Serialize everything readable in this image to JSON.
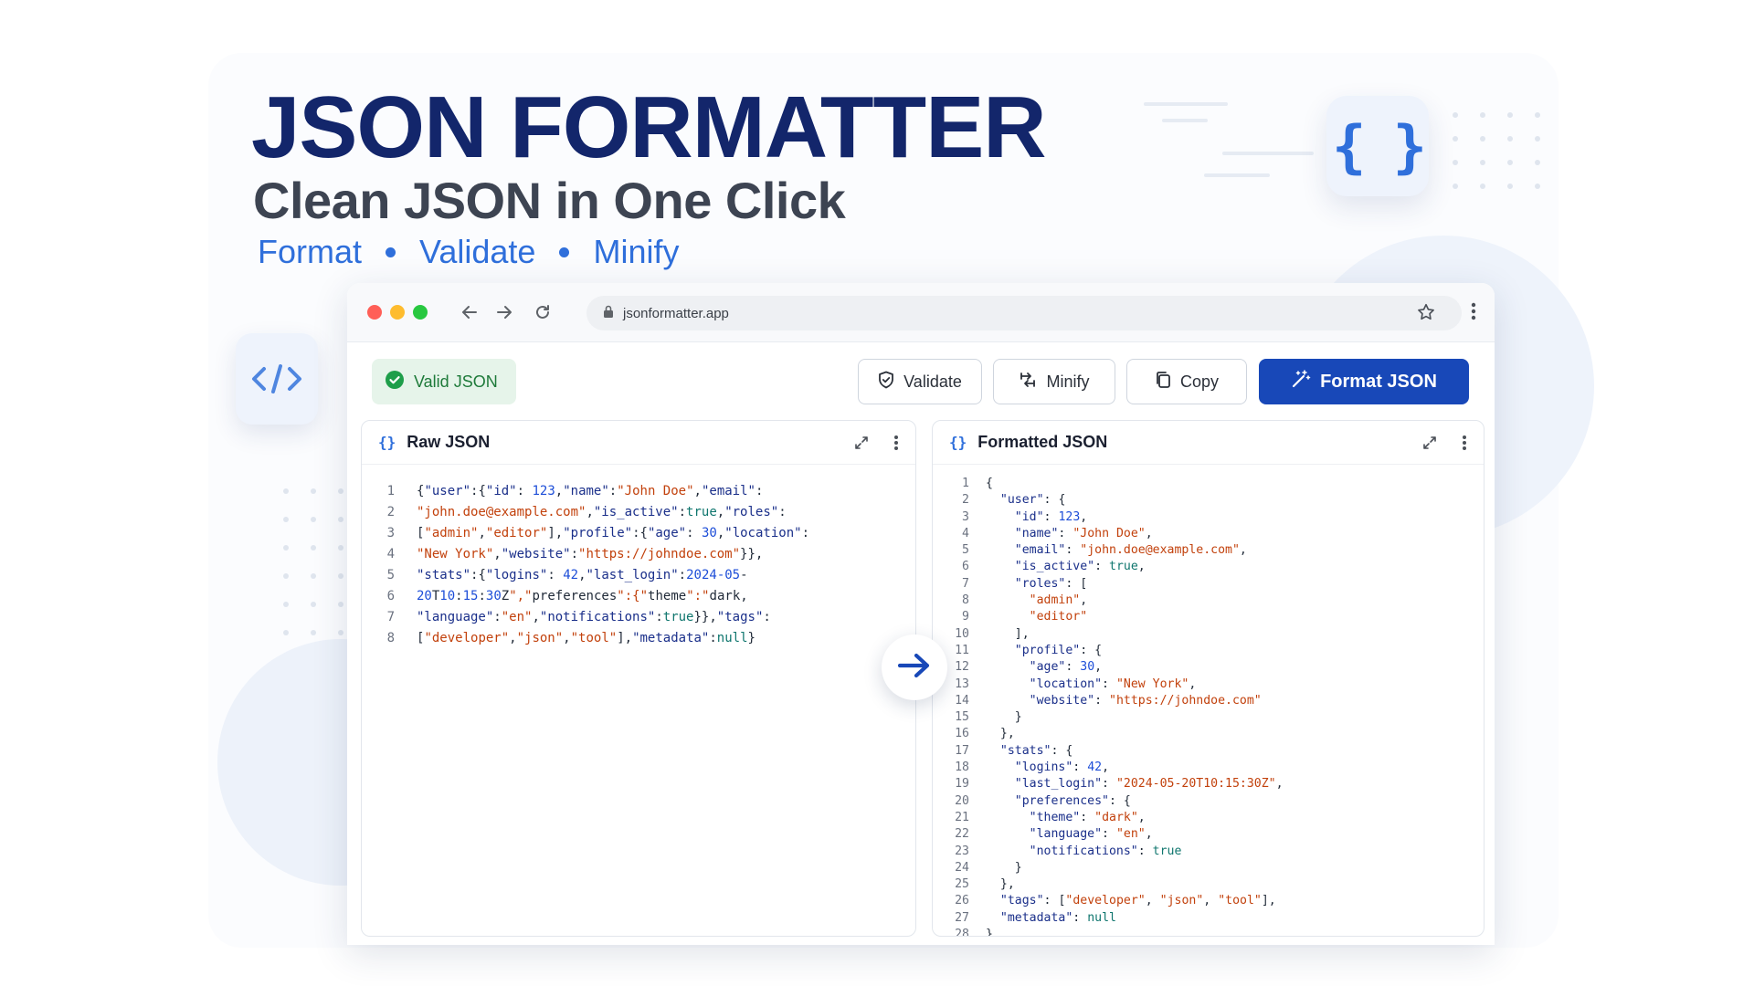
{
  "hero": {
    "title": "JSON FORMATTER",
    "subtitle": "Clean JSON in One Click",
    "features": [
      "Format",
      "Validate",
      "Minify"
    ],
    "badge_glyph": "{ }"
  },
  "colors": {
    "primary": "#1848b8",
    "title": "#13266b",
    "accent": "#2f6fdb",
    "valid_bg": "#e6f4ea",
    "valid_text": "#1e7a3a"
  },
  "browser": {
    "url": "jsonformatter.app",
    "icons": [
      "back-arrow-icon",
      "forward-arrow-icon",
      "reload-icon",
      "lock-icon",
      "star-icon",
      "kebab-menu-icon"
    ]
  },
  "toolbar": {
    "status_label": "Valid JSON",
    "validate_label": "Validate",
    "minify_label": "Minify",
    "copy_label": "Copy",
    "format_label": "Format JSON"
  },
  "raw_pane": {
    "title": "Raw JSON",
    "lines": [
      "{\"user\":{\"id\": 123,\"name\":\"John Doe\",\"email\":",
      "\"john.doe@example.com\",\"is_active\":true,\"roles\":",
      "[\"admin\",\"editor\"],\"profile\":{\"age\": 30,\"location\":",
      "\"New York\",\"website\":\"https://johndoe.com\"}},\"",
      "\"stats\":{\"logins\": 42,\"last_login\":\"2024-05-",
      "20T10:15:30Z\",\"preferences\":{\"theme\":\"dark\",",
      "\"language\":\"en\",\"notifications\":true}},\"tags\":",
      "[\"developer\",\"json\",\"tool\"],\"metadata\":null}"
    ]
  },
  "formatted_pane": {
    "title": "Formatted JSON",
    "lines": [
      "{",
      "  \"user\": {",
      "    \"id\": 123,",
      "    \"name\": \"John Doe\",",
      "    \"email\": \"john.doe@example.com\",",
      "    \"is_active\": true,",
      "    \"roles\": [",
      "      \"admin\",",
      "      \"editor\"",
      "    ],",
      "    \"profile\": {",
      "      \"age\": 30,",
      "      \"location\": \"New York\",",
      "      \"website\": \"https://johndoe.com\"",
      "    }",
      "  },",
      "  \"stats\": {",
      "    \"logins\": 42,",
      "    \"last_login\": \"2024-05-20T10:15:30Z\",",
      "    \"preferences\": {",
      "      \"theme\": \"dark\",",
      "      \"language\": \"en\",",
      "      \"notifications\": true",
      "    }",
      "  },",
      "  \"tags\": [\"developer\", \"json\", \"tool\"],",
      "  \"metadata\": null",
      "}"
    ]
  }
}
